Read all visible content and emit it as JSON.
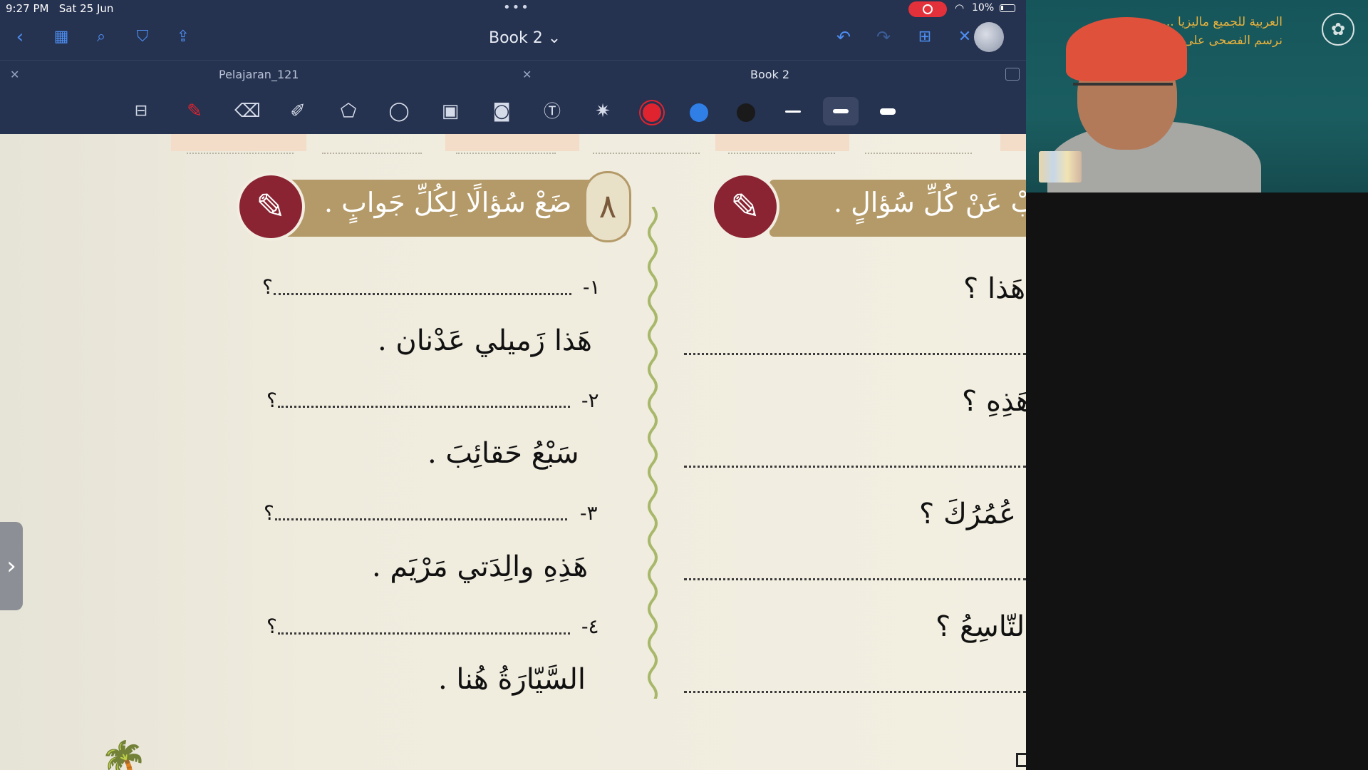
{
  "status_bar": {
    "time": "9:27 PM",
    "date": "Sat 25 Jun",
    "battery": "10%",
    "wifi_icon": "wifi-icon"
  },
  "nav": {
    "book_title": "Book 2 ⌄"
  },
  "tabs": [
    {
      "label": "Pelajaran_121"
    },
    {
      "label": "Book 2"
    }
  ],
  "toolbar": {
    "colors": [
      "#e0242f",
      "#2f7fe6",
      "#1a1a1a"
    ],
    "tools": [
      "page-layout-icon",
      "pen-icon",
      "eraser-icon",
      "highlighter-icon",
      "shapes-icon",
      "lasso-icon",
      "image-icon",
      "camera-icon",
      "text-box-icon",
      "laser-pointer-icon"
    ]
  },
  "left_exercise": {
    "number": "٨",
    "title": "ضَعْ سُؤالًا لِكُلِّ جَوابٍ .",
    "items": [
      {
        "num": "١-",
        "q": "؟",
        "answer": "هَذا زَميلي عَدْنان ."
      },
      {
        "num": "٢-",
        "q": "؟",
        "answer": "سَبْعُ حَقائِبَ ."
      },
      {
        "num": "٣-",
        "q": "؟",
        "answer": "هَذِهِ والِدَتي مَرْيَم ."
      },
      {
        "num": "٤-",
        "q": "؟",
        "answer": "السَّيّارَةُ هُنا ."
      }
    ]
  },
  "right_exercise": {
    "title": "ـجِبْ عَنْ كُلِّ سُؤالٍ .",
    "questions": [
      "هَذا ؟",
      "هَذِهِ ؟",
      "ـمْ عُمُرُكَ ؟",
      "التّاسِعُ ؟"
    ]
  },
  "webcam": {
    "caption": "العربية للجميع ماليزيا ... نرسم الفصحى على ..."
  }
}
